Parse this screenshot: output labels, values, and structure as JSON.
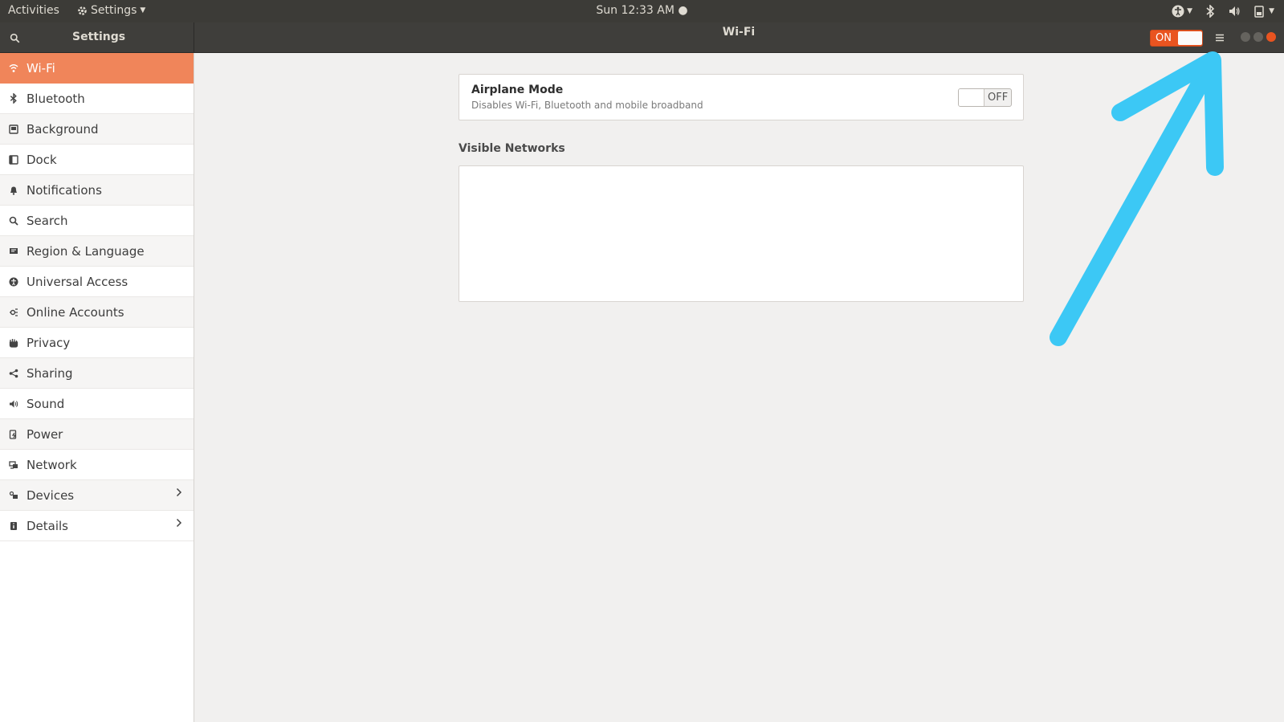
{
  "top_panel": {
    "activities": "Activities",
    "app_menu": "Settings",
    "clock": "Sun 12:33 AM"
  },
  "header": {
    "sidebar_title": "Settings",
    "title": "Wi-Fi",
    "wifi_switch_label": "ON"
  },
  "sidebar": {
    "items": [
      {
        "label": "Wi-Fi",
        "icon": "wifi-icon"
      },
      {
        "label": "Bluetooth",
        "icon": "bluetooth-icon"
      },
      {
        "label": "Background",
        "icon": "background-icon"
      },
      {
        "label": "Dock",
        "icon": "dock-icon"
      },
      {
        "label": "Notifications",
        "icon": "bell-icon"
      },
      {
        "label": "Search",
        "icon": "search-icon"
      },
      {
        "label": "Region & Language",
        "icon": "flag-icon"
      },
      {
        "label": "Universal Access",
        "icon": "accessibility-icon"
      },
      {
        "label": "Online Accounts",
        "icon": "online-accounts-icon"
      },
      {
        "label": "Privacy",
        "icon": "hand-icon"
      },
      {
        "label": "Sharing",
        "icon": "share-icon"
      },
      {
        "label": "Sound",
        "icon": "speaker-icon"
      },
      {
        "label": "Power",
        "icon": "power-icon"
      },
      {
        "label": "Network",
        "icon": "network-icon"
      },
      {
        "label": "Devices",
        "icon": "devices-icon"
      },
      {
        "label": "Details",
        "icon": "info-icon"
      }
    ]
  },
  "main": {
    "airplane_title": "Airplane Mode",
    "airplane_subtitle": "Disables Wi-Fi, Bluetooth and mobile broadband",
    "airplane_switch_label": "OFF",
    "visible_networks_label": "Visible Networks"
  },
  "colors": {
    "accent": "#e95420",
    "sidebar_active": "#f0855a",
    "annotation_arrow": "#3cc8f5"
  }
}
